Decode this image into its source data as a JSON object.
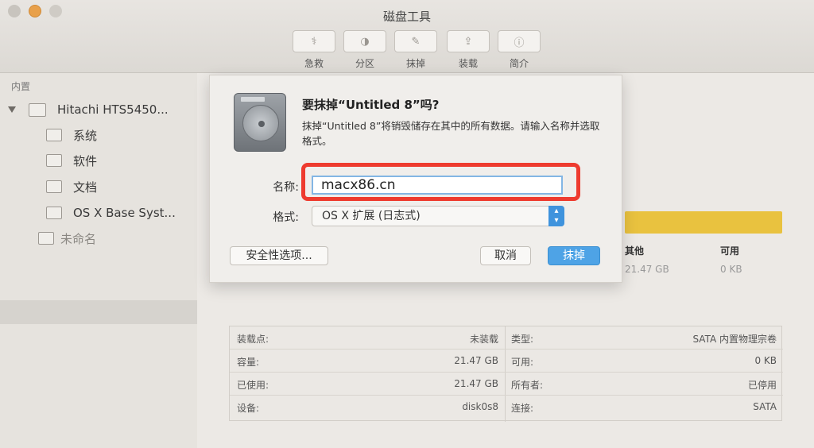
{
  "app": {
    "title": "磁盘工具"
  },
  "toolbar": [
    {
      "label": "急救",
      "icon": "stethoscope-icon",
      "glyph": "⚕"
    },
    {
      "label": "分区",
      "icon": "partition-icon",
      "glyph": "◑"
    },
    {
      "label": "抹掉",
      "icon": "erase-icon",
      "glyph": "✎"
    },
    {
      "label": "装载",
      "icon": "mount-icon",
      "glyph": "⇪"
    },
    {
      "label": "简介",
      "icon": "info-icon",
      "glyph": "ⓘ"
    }
  ],
  "sidebar": {
    "section": "内置",
    "items": [
      {
        "label": "Hitachi HTS5450...",
        "level": 0
      },
      {
        "label": "系统",
        "level": 1
      },
      {
        "label": "软件",
        "level": 1
      },
      {
        "label": "文档",
        "level": 1
      },
      {
        "label": "OS X Base Syst...",
        "level": 1
      },
      {
        "label": "未命名",
        "level": 1,
        "selected": true
      }
    ]
  },
  "dialog": {
    "title": "要抹掉“Untitled 8”吗?",
    "description": "抹掉“Untitled 8”将销毁储存在其中的所有数据。请输入名称并选取格式。",
    "name_label": "名称:",
    "name_value": "macx86.cn",
    "format_label": "格式:",
    "format_value": "OS X 扩展 (日志式)",
    "security_button": "安全性选项...",
    "cancel_button": "取消",
    "erase_button": "抹掉"
  },
  "usage": {
    "bar_color": "#e9c23f",
    "legend": [
      {
        "label": "其他",
        "value": "21.47 GB"
      },
      {
        "label": "可用",
        "value": "0 KB"
      }
    ]
  },
  "info": {
    "rows": [
      {
        "l1": "装载点:",
        "v1": "未装载",
        "l2": "类型:",
        "v2": "SATA 内置物理宗卷"
      },
      {
        "l1": "容量:",
        "v1": "21.47 GB",
        "l2": "可用:",
        "v2": "0 KB"
      },
      {
        "l1": "已使用:",
        "v1": "21.47 GB",
        "l2": "所有者:",
        "v2": "已停用"
      },
      {
        "l1": "设备:",
        "v1": "disk0s8",
        "l2": "连接:",
        "v2": "SATA"
      }
    ]
  },
  "colors": {
    "accent": "#4ea3e6",
    "highlight": "#ee3b2f"
  }
}
